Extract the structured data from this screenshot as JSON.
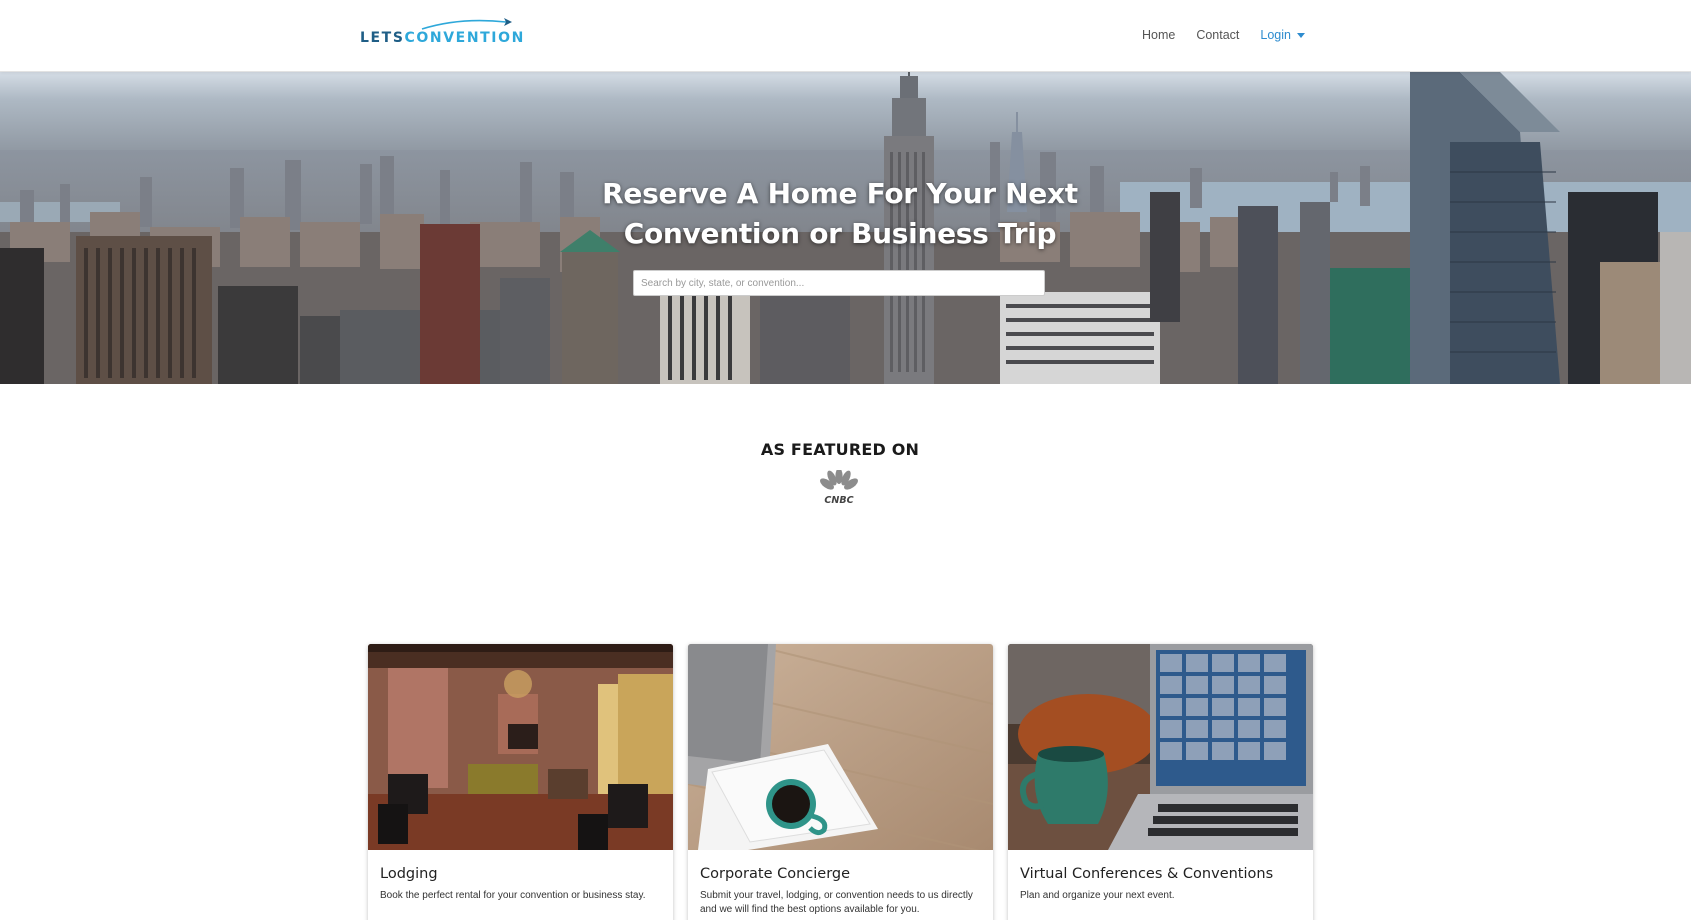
{
  "brand": {
    "logo_part1": "LETS",
    "logo_part2": "CONVENTION",
    "primary_color": "#1f5e86",
    "accent_color": "#2ea8da"
  },
  "nav": {
    "home": "Home",
    "contact": "Contact",
    "login": "Login"
  },
  "hero": {
    "title_line1": "Reserve A Home For Your Next",
    "title_line2": "Convention or Business Trip",
    "search_placeholder": "Search by city, state, or convention...",
    "search_value": ""
  },
  "featured": {
    "heading": "AS FEATURED ON",
    "logo_text": "CNBC",
    "logo_icon": "cnbc-peacock-icon"
  },
  "cards": [
    {
      "title": "Lodging",
      "text": "Book the perfect rental for your convention or business stay."
    },
    {
      "title": "Corporate Concierge",
      "text": "Submit your travel, lodging, or convention needs to us directly and we will find the best options available for you."
    },
    {
      "title": "Virtual Conferences & Conventions",
      "text": "Plan and organize your next event."
    }
  ]
}
